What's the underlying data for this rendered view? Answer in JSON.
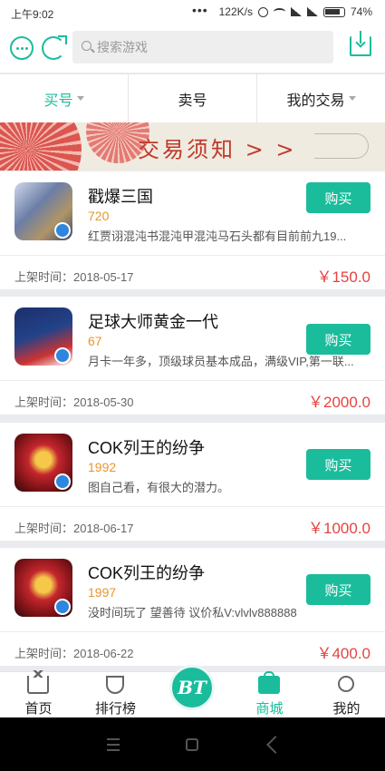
{
  "status_bar": {
    "time": "上午9:02",
    "dots": "•••",
    "speed": "122K/s",
    "battery": "74%"
  },
  "search": {
    "placeholder": "搜索游戏"
  },
  "tabs": [
    {
      "label": "买号",
      "active": true,
      "has_caret": true
    },
    {
      "label": "卖号",
      "active": false,
      "has_caret": false
    },
    {
      "label": "我的交易",
      "active": false,
      "has_caret": true
    }
  ],
  "banner": {
    "text": "交易须知 > >"
  },
  "listings": [
    {
      "icon": "game-icon-chuangbao",
      "title": "戳爆三国",
      "number": "720",
      "desc": "红贾诩混沌书混沌甲混沌马石头都有目前前九19...",
      "buy_label": "购买",
      "date": "上架时间：2018-05-17",
      "price": "￥150.0"
    },
    {
      "icon": "game-icon-football",
      "title": "足球大师黄金一代",
      "number": "67",
      "desc": "月卡一年多，顶级球员基本成品，满级VIP,第一联...",
      "buy_label": "购买",
      "date": "上架时间：2018-05-30",
      "price": "￥2000.0"
    },
    {
      "icon": "game-icon-cok",
      "title": "COK列王的纷争",
      "number": "1992",
      "desc": "图自己看，有很大的潜力。",
      "buy_label": "购买",
      "date": "上架时间：2018-06-17",
      "price": "￥1000.0"
    },
    {
      "icon": "game-icon-cok",
      "title": "COK列王的纷争",
      "number": "1997",
      "desc": "没时间玩了 望善待 议价私V:vlvlv888888",
      "buy_label": "购买",
      "date": "上架时间：2018-06-22",
      "price": "￥400.0"
    }
  ],
  "bottom_nav": {
    "home": "首页",
    "ranking": "排行榜",
    "center": "BT",
    "mall": "商城",
    "mine": "我的"
  },
  "colors": {
    "accent": "#1bbc9b",
    "price": "#e64340",
    "number": "#e8962c"
  }
}
